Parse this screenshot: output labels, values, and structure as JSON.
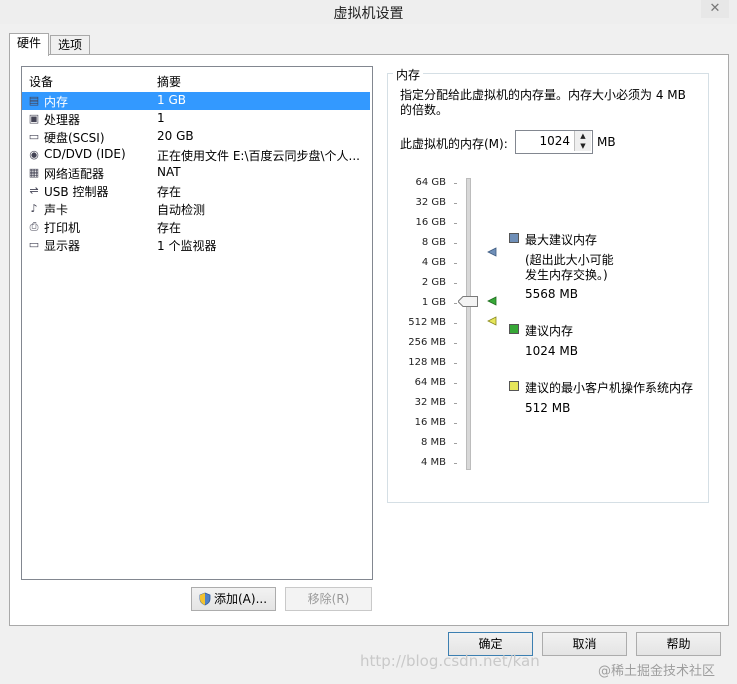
{
  "window": {
    "title": "虚拟机设置",
    "close_glyph": "✕"
  },
  "tabs": [
    {
      "label": "硬件"
    },
    {
      "label": "选项"
    }
  ],
  "device_list": {
    "headers": {
      "device": "设备",
      "summary": "摘要"
    },
    "rows": [
      {
        "icon": "memory-icon",
        "glyph": "▤",
        "name": "内存",
        "summary": "1 GB"
      },
      {
        "icon": "cpu-icon",
        "glyph": "▣",
        "name": "处理器",
        "summary": "1"
      },
      {
        "icon": "harddisk-icon",
        "glyph": "▭",
        "name": "硬盘(SCSI)",
        "summary": "20 GB"
      },
      {
        "icon": "cdrom-icon",
        "glyph": "◉",
        "name": "CD/DVD (IDE)",
        "summary": "正在使用文件 E:\\百度云同步盘\\个人..."
      },
      {
        "icon": "network-icon",
        "glyph": "▦",
        "name": "网络适配器",
        "summary": "NAT"
      },
      {
        "icon": "usb-icon",
        "glyph": "⇌",
        "name": "USB 控制器",
        "summary": "存在"
      },
      {
        "icon": "sound-icon",
        "glyph": "♪",
        "name": "声卡",
        "summary": "自动检测"
      },
      {
        "icon": "printer-icon",
        "glyph": "⎙",
        "name": "打印机",
        "summary": "存在"
      },
      {
        "icon": "display-icon",
        "glyph": "▭",
        "name": "显示器",
        "summary": "1 个监视器"
      }
    ]
  },
  "buttons": {
    "add": "添加(A)...",
    "remove": "移除(R)",
    "ok": "确定",
    "cancel": "取消",
    "help": "帮助"
  },
  "memory_panel": {
    "group_label": "内存",
    "description": "指定分配给此虚拟机的内存量。内存大小必须为 4 MB 的倍数。",
    "field_label": "此虚拟机的内存(M):",
    "value": "1024",
    "unit": "MB",
    "scale": [
      "64 GB",
      "32 GB",
      "16 GB",
      "8 GB",
      "4 GB",
      "2 GB",
      "1 GB",
      "512 MB",
      "256 MB",
      "128 MB",
      "64 MB",
      "32 MB",
      "16 MB",
      "8 MB",
      "4 MB"
    ],
    "slider_value": "1 GB",
    "legend": {
      "max": {
        "title": "最大建议内存",
        "note_line1": "(超出此大小可能",
        "note_line2": "发生内存交换。)",
        "value": "5568 MB",
        "color": "#6f8fb8"
      },
      "recommended": {
        "title": "建议内存",
        "value": "1024 MB",
        "color": "#37a837"
      },
      "min": {
        "title": "建议的最小客户机操作系统内存",
        "value": "512 MB",
        "color": "#e6e65a"
      }
    }
  },
  "watermark": {
    "url": "http://blog.csdn.net/kan",
    "brand": "@稀土掘金技术社区"
  }
}
